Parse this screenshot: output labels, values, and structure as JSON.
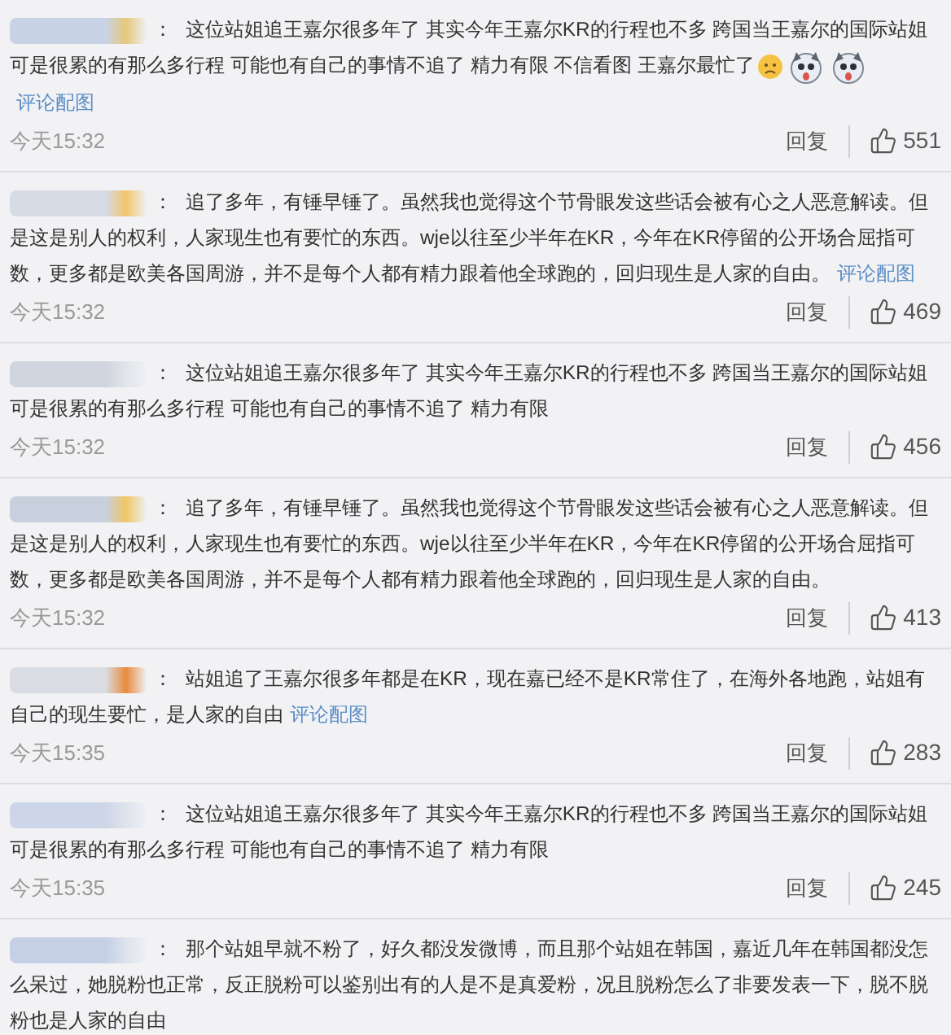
{
  "comments": [
    {
      "colon": "：",
      "text": "这位站姐追王嘉尔很多年了 其实今年王嘉尔KR的行程也不多 跨国当王嘉尔的国际站姐可是很累的有那么多行程 可能也有自己的事情不追了 精力有限 不信看图 王嘉尔最忙了",
      "stickers": [
        {
          "kind": "face"
        },
        {
          "kind": "dog"
        },
        {
          "kind": "dog"
        }
      ],
      "image_link": "评论配图",
      "time": "今天15:32",
      "reply": "回复",
      "likes": "551"
    },
    {
      "colon": "：",
      "text": "追了多年，有锤早锤了。虽然我也觉得这个节骨眼发这些话会被有心之人恶意解读。但是这是别人的权利，人家现生也有要忙的东西。wje以往至少半年在KR，今年在KR停留的公开场合屈指可数，更多都是欧美各国周游，并不是每个人都有精力跟着他全球跑的，回归现生是人家的自由。",
      "image_link": "评论配图",
      "time": "今天15:32",
      "reply": "回复",
      "likes": "469"
    },
    {
      "colon": "：",
      "text": "这位站姐追王嘉尔很多年了 其实今年王嘉尔KR的行程也不多 跨国当王嘉尔的国际站姐可是很累的有那么多行程 可能也有自己的事情不追了 精力有限",
      "time": "今天15:32",
      "reply": "回复",
      "likes": "456"
    },
    {
      "colon": "：",
      "text": "追了多年，有锤早锤了。虽然我也觉得这个节骨眼发这些话会被有心之人恶意解读。但是这是别人的权利，人家现生也有要忙的东西。wje以往至少半年在KR，今年在KR停留的公开场合屈指可数，更多都是欧美各国周游，并不是每个人都有精力跟着他全球跑的，回归现生是人家的自由。",
      "time": "今天15:32",
      "reply": "回复",
      "likes": "413"
    },
    {
      "colon": "：",
      "text": "站姐追了王嘉尔很多年都是在KR，现在嘉已经不是KR常住了，在海外各地跑，站姐有自己的现生要忙，是人家的自由",
      "image_link": "评论配图",
      "time": "今天15:35",
      "reply": "回复",
      "likes": "283"
    },
    {
      "colon": "：",
      "text": "这位站姐追王嘉尔很多年了 其实今年王嘉尔KR的行程也不多 跨国当王嘉尔的国际站姐可是很累的有那么多行程 可能也有自己的事情不追了 精力有限",
      "time": "今天15:35",
      "reply": "回复",
      "likes": "245"
    },
    {
      "colon": "：",
      "text": "那个站姐早就不粉了，好久都没发微博，而且那个站姐在韩国，嘉近几年在韩国都没怎么呆过，她脱粉也正常，反正脱粉可以鉴别出有的人是不是真爱粉，况且脱粉怎么了非要发表一下，脱不脱粉也是人家的自由"
    }
  ]
}
